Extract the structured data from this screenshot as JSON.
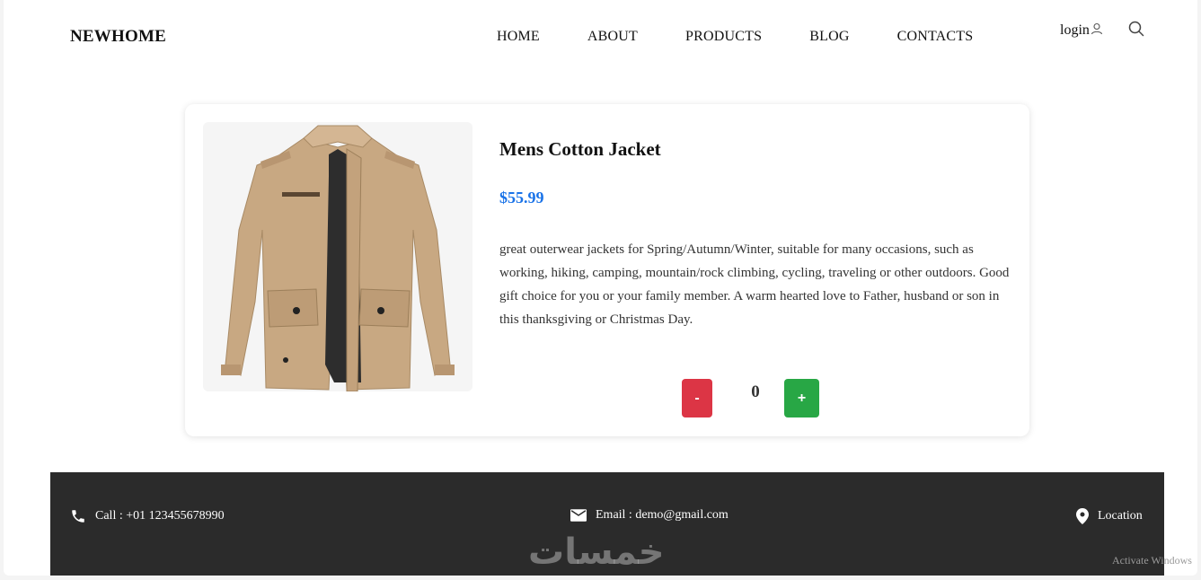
{
  "header": {
    "logo": "NEWHOME",
    "nav": [
      "HOME",
      "ABOUT",
      "PRODUCTS",
      "BLOG",
      "CONTACTS"
    ],
    "login_label": "login",
    "search_icon": "search-icon",
    "user_icon": "user-icon"
  },
  "product": {
    "title": "Mens Cotton Jacket",
    "price": "$55.99",
    "description": "great outerwear jackets for Spring/Autumn/Winter, suitable for many occasions, such as working, hiking, camping, mountain/rock climbing, cycling, traveling or other outdoors. Good gift choice for you or your family member. A warm hearted love to Father, husband or son in this thanksgiving or Christmas Day.",
    "quantity": "0",
    "minus_label": "-",
    "plus_label": "+",
    "price_color": "#1a73e8",
    "minus_color": "#dc3545",
    "plus_color": "#28a745"
  },
  "footer": {
    "call": "Call : +01 123455678990",
    "email": "Email : demo@gmail.com",
    "location": "Location",
    "background": "#2b2b2b"
  },
  "overlay": {
    "watermark": "خمسات",
    "activate_windows": "Activate Windows"
  }
}
